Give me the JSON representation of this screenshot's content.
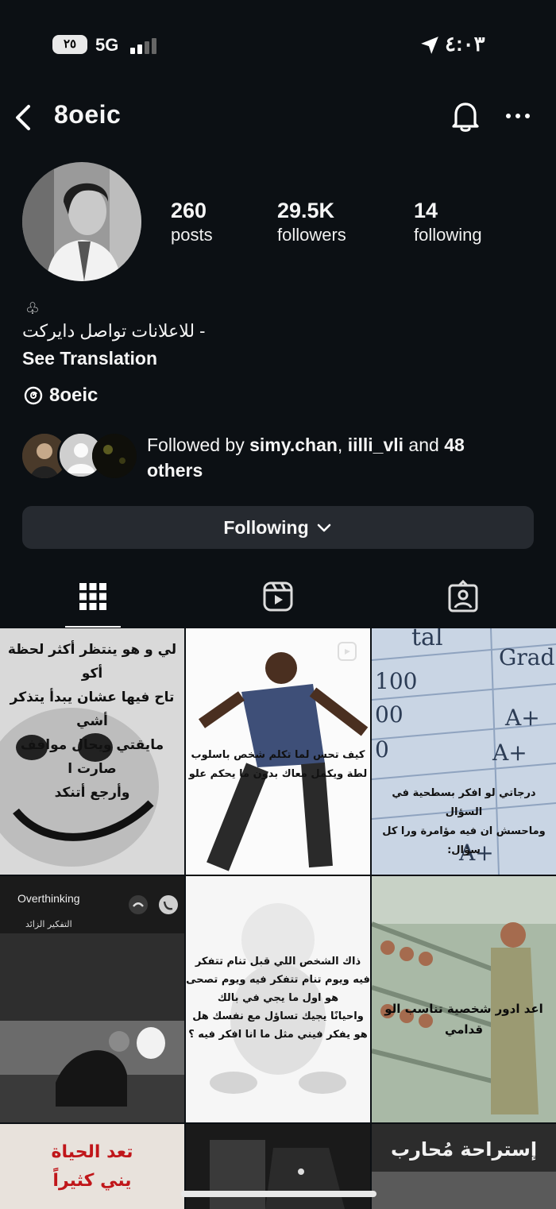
{
  "status_bar": {
    "battery": "٢٥",
    "network": "5G",
    "time": "٤:٠٣"
  },
  "header": {
    "username": "8oeic"
  },
  "profile": {
    "stats": [
      {
        "value": "260",
        "label": "posts"
      },
      {
        "value": "29.5K",
        "label": "followers"
      },
      {
        "value": "14",
        "label": "following"
      }
    ],
    "bio_symbol": "♧",
    "bio_text": "للاعلانات تواصل دايركت -",
    "see_translation": "See Translation",
    "threads_handle": "8oeic",
    "followed_by": {
      "prefix": "Followed by ",
      "user1": "simy.chan",
      "sep": ", ",
      "user2": "iilli_vli",
      "and": " and ",
      "count": "48",
      "others": "others"
    },
    "following_button": "Following"
  },
  "grid": {
    "post1_text": "لي و هو ينتظر أكثر لحظة أكو\nتاح فيها عشان يبدأ يتذكر أشي\nمايقتي ويحال مواقف صارت ا\nوأرجع أتنكد",
    "post2_text": "كيف تحس لما تكلم شخص باسلوب\nلطة ويكمل معاك بدون ما يحكم علو",
    "post3_sheet": [
      "tal",
      "Grad",
      "100",
      "A+",
      "00",
      "A+",
      "0",
      "A+"
    ],
    "post3_text": "درجاتي لو افكر بسطحية في السؤال\nوماحسش ان فيه مؤامرة ورا كل\nسؤال:",
    "post4_title": "Overthinking",
    "post4_subtitle": "التفكير الزائد",
    "post5_text": "ذاك الشخص اللي قبل تنام تتفكر\nفيه ويوم تنام تتفكر فيه ويوم تصحى\nهو اول ما يجي في بالك\nواحيانًا يجيك تساؤل مع نفسك هل\nهو يفكر فيني مثل ما انا افكر فيه ؟",
    "post6_text": "اعد ادور شخصية تناسب الو\nقدامي",
    "post7_text": "تعد الحياة\nيني كثيراً",
    "post9_text": "إستراحة مُحارب"
  }
}
